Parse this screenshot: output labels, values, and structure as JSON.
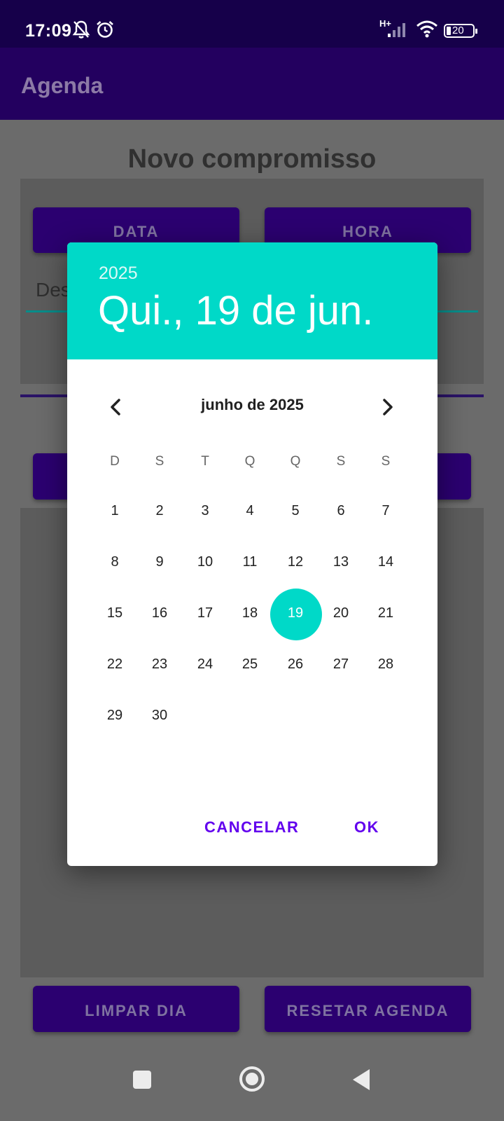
{
  "status": {
    "time": "17:09",
    "network": "H+",
    "battery": "20"
  },
  "app": {
    "title": "Agenda"
  },
  "form": {
    "title": "Novo compromisso",
    "data_button": "DATA",
    "hora_button": "HORA",
    "description_value": "Des"
  },
  "footer": {
    "limpar_button": "LIMPAR DIA",
    "resetar_button": "RESETAR AGENDA"
  },
  "dialog": {
    "year": "2025",
    "selected_date": "Qui., 19 de jun.",
    "month_label": "junho de 2025",
    "weekdays": [
      "D",
      "S",
      "T",
      "Q",
      "Q",
      "S",
      "S"
    ],
    "days": [
      "1",
      "2",
      "3",
      "4",
      "5",
      "6",
      "7",
      "8",
      "9",
      "10",
      "11",
      "12",
      "13",
      "14",
      "15",
      "16",
      "17",
      "18",
      "19",
      "20",
      "21",
      "22",
      "23",
      "24",
      "25",
      "26",
      "27",
      "28",
      "29",
      "30"
    ],
    "selected_day": "19",
    "cancel_label": "CANCELAR",
    "ok_label": "OK"
  },
  "colors": {
    "accent": "#00d9c8",
    "primary": "#6200ee",
    "appbar": "#23005f"
  },
  "icons": [
    "notifications-off-icon",
    "alarm-icon",
    "signal-icon",
    "wifi-icon",
    "battery-icon",
    "chevron-left-icon",
    "chevron-right-icon",
    "nav-recents-icon",
    "nav-home-icon",
    "nav-back-icon"
  ]
}
